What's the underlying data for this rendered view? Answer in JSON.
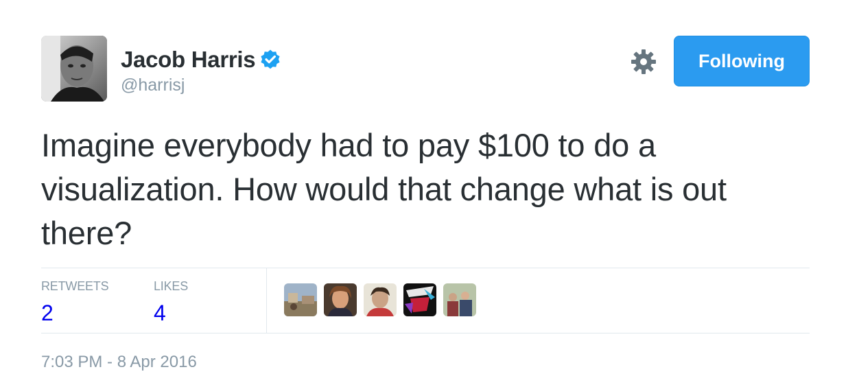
{
  "author": {
    "display_name": "Jacob Harris",
    "handle": "@harrisj",
    "verified_icon": "verified-badge-icon",
    "avatar_icon": "user-avatar"
  },
  "actions": {
    "settings_icon": "gear-icon",
    "follow_label": "Following"
  },
  "tweet": {
    "text": "Imagine everybody had to pay $100 to do a visualization. How would that change what is out there?"
  },
  "stats": {
    "retweets_label": "RETWEETS",
    "retweets_count": "2",
    "likes_label": "LIKES",
    "likes_count": "4"
  },
  "timestamp": "7:03 PM - 8 Apr 2016",
  "colors": {
    "accent": "#2b9bf0",
    "verified": "#1da1f2",
    "muted": "#8899a6",
    "text": "#292f33",
    "count": "#0000ee"
  }
}
